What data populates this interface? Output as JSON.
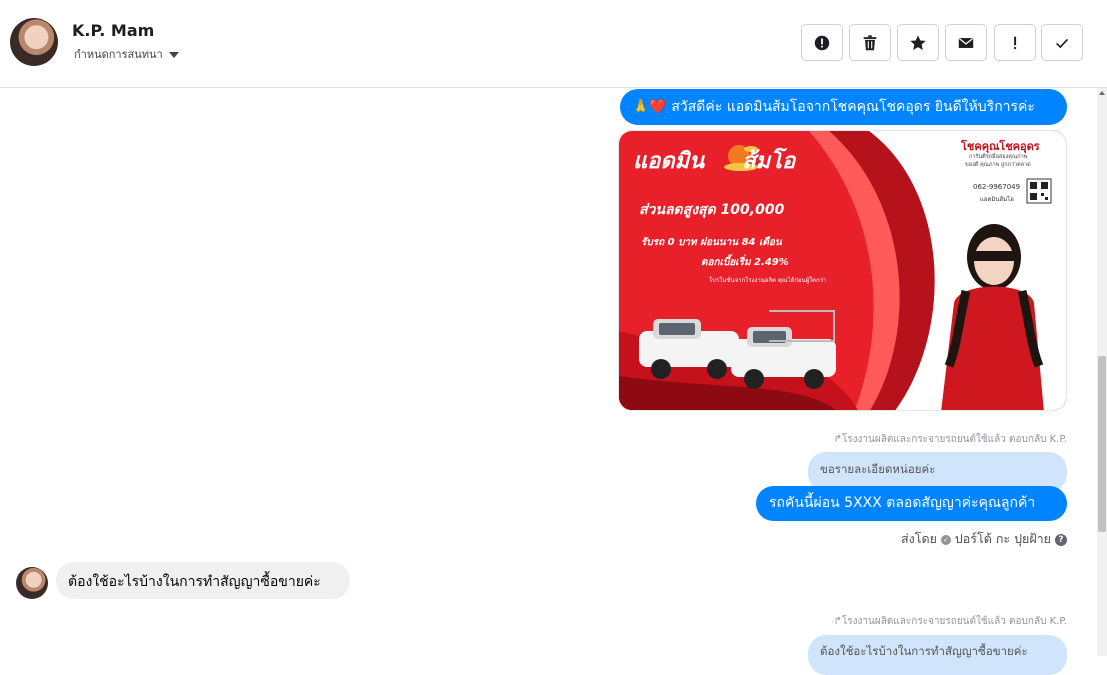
{
  "header": {
    "name": "K.P. Mam",
    "assign_label": "กำหนดการสนทนา",
    "tools": [
      {
        "icon": "alert-circle-icon"
      },
      {
        "icon": "trash-icon"
      },
      {
        "icon": "star-icon"
      },
      {
        "icon": "envelope-icon"
      },
      {
        "icon": "exclamation-icon"
      },
      {
        "icon": "checkmark-icon"
      }
    ]
  },
  "messages": {
    "greeting": "🙏❤️ สวัสดีค่ะ แอดมินส้มโอจากโชคคุณโชคอุดร ยินดีให้บริการค่ะ",
    "ad": {
      "brand": "แอดมิน",
      "brand2": "ส้มโอ",
      "headline": "ส่วนลดสูงสุด 100,000",
      "line2": "รับรถ 0 บาท ผ่อนนาน 84 เดือน",
      "line3": "ดอกเบี้ยเริ่ม 2.49%",
      "line4": "โปรโมชั่นจากโรงงานผลิต คุณได้ก่อนผู้ใดกว่า",
      "company": "โชคคุณโชคอุดร",
      "company_sub": "การันตีรถมือสองคุณภาพ",
      "company_sub2": "ของดี คุณภาพ ถูกกว่าตลาด",
      "phone": "062-9967049",
      "phone_label": "แอดมินส้มโอ"
    },
    "reply_meta_1": "โรงงานผลิตและกระจายรถยนต์ใช้แล้ว ตอบกลับ K.P.",
    "reply_quote_1": "ขอรายละเอียดหน่อยค่ะ",
    "reply_text_1": "รถคันนี้ผ่อน 5XXX  ตลอดสัญญาค่ะคุณลูกค้า",
    "sent_by": "ส่งโดย",
    "sent_by_name": "ปอร์โต้ กะ ปุยฝ้าย",
    "customer_msg": "ต้องใช้อะไรบ้างในการทำสัญญาซื้อขายค่ะ",
    "reply_meta_2": "โรงงานผลิตและกระจายรถยนต์ใช้แล้ว ตอบกลับ K.P.",
    "reply_quote_2": "ต้องใช้อะไรบ้างในการทำสัญญาซื้อขายค่ะ"
  },
  "colors": {
    "accent": "#0084ff",
    "reply_bg": "#d0e4fb",
    "ad_red": "#e8202a"
  }
}
